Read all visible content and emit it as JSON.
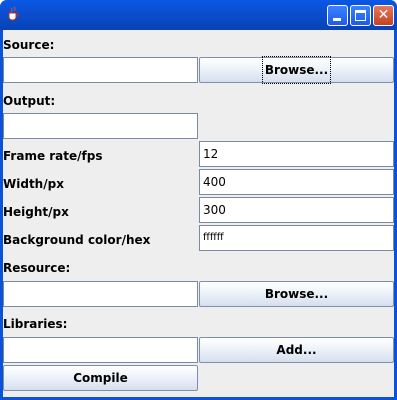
{
  "window": {
    "title": "",
    "icon": "java-cup-icon"
  },
  "source": {
    "label": "Source:",
    "value": "",
    "browse_label": "Browse..."
  },
  "output": {
    "label": "Output:",
    "value": ""
  },
  "frame_rate": {
    "label": "Frame rate/fps",
    "value": "12"
  },
  "width": {
    "label": "Width/px",
    "value": "400"
  },
  "height": {
    "label": "Height/px",
    "value": "300"
  },
  "background": {
    "label": "Background color/hex",
    "value": "ffffff"
  },
  "resource": {
    "label": "Resource:",
    "value": "",
    "browse_label": "Browse..."
  },
  "libraries": {
    "label": "Libraries:",
    "value": "",
    "add_label": "Add..."
  },
  "compile_label": "Compile",
  "colors": {
    "titlebar": "#0a52d8",
    "panel": "#eeeeee",
    "close_button": "#c4411f"
  }
}
